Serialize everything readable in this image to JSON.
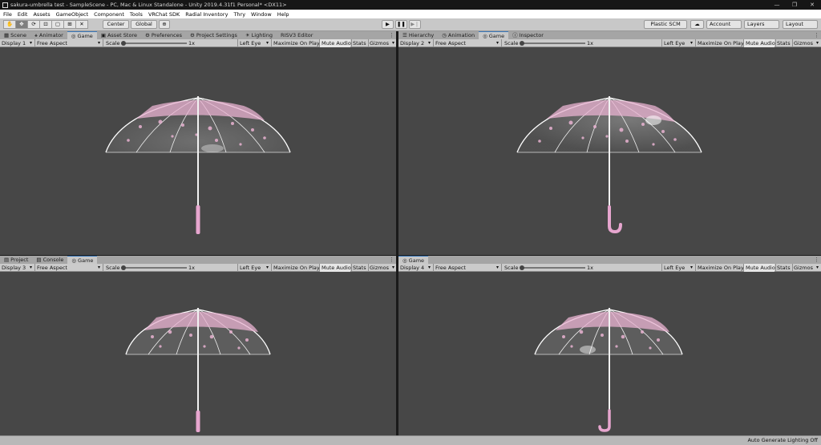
{
  "window": {
    "title": "sakura-umbrella test - SampleScene - PC, Mac & Linux Standalone - Unity 2019.4.31f1 Personal* <DX11>",
    "minimize": "—",
    "restore": "❐",
    "close": "✕"
  },
  "menu": [
    "File",
    "Edit",
    "Assets",
    "GameObject",
    "Component",
    "Tools",
    "VRChat SDK",
    "Radial Inventory",
    "Thry",
    "Window",
    "Help"
  ],
  "toolbar": {
    "pivot_label": "Center",
    "space_label": "Global",
    "plastic_label": "Plastic SCM",
    "account_label": "Account",
    "layers_label": "Layers",
    "layout_label": "Layout"
  },
  "panes": {
    "top_left": {
      "tabs": [
        "Scene",
        "Animator",
        "Game",
        "Asset Store",
        "Preferences",
        "Project Settings",
        "Lighting",
        "RISV3 Editor"
      ],
      "display": "Display 1"
    },
    "top_right": {
      "tabs": [
        "Hierarchy",
        "Animation",
        "Game",
        "Inspector"
      ],
      "display": "Display 2"
    },
    "bottom_left": {
      "tabs": [
        "Project",
        "Console",
        "Game"
      ],
      "display": "Display 3"
    },
    "bottom_right": {
      "tabs": [
        "Game"
      ],
      "display": "Display 4"
    }
  },
  "game_controls": {
    "aspect": "Free Aspect",
    "scale_label": "Scale",
    "scale_value": "1x",
    "eye": "Left Eye",
    "maximize": "Maximize On Play",
    "mute": "Mute Audio",
    "stats": "Stats",
    "gizmos": "Gizmos"
  },
  "status": "Auto Generate Lighting Off",
  "colors": {
    "viewport": "#474747",
    "canopy_rim": "#ffffff",
    "sakura_pink": "#e9b3d2",
    "handle_pink": "#e7a6cf"
  }
}
